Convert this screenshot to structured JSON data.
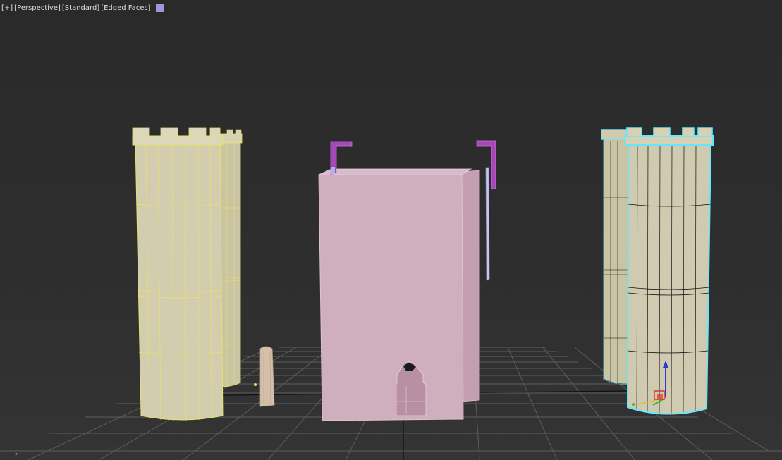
{
  "viewport": {
    "labels": [
      "[+]",
      "[Perspective]",
      "[Standard]",
      "[Edged Faces]"
    ],
    "swatch_color": "#9b98d8",
    "axis_corner_label": "z"
  },
  "colors": {
    "background": "#2b2b2b",
    "grid": "#5e5e5e",
    "grid_axis": "#0f0f0f",
    "tower_fill": "#d2cdae",
    "tower_wire": "#e7e26a",
    "keep_fill": "#cfafbe",
    "selection": "#64e8ff",
    "arm": "#a648b9",
    "door": "#d6bfa8",
    "gizmo_z": "#2b3ccc",
    "gizmo_x": "#d83535",
    "gizmo_y": "#3fb83f"
  },
  "objects": [
    "tower-left-front",
    "tower-left-back",
    "gate-keep",
    "arm-left",
    "arm-right",
    "door-piece",
    "tower-right-selected",
    "tower-right-back"
  ]
}
